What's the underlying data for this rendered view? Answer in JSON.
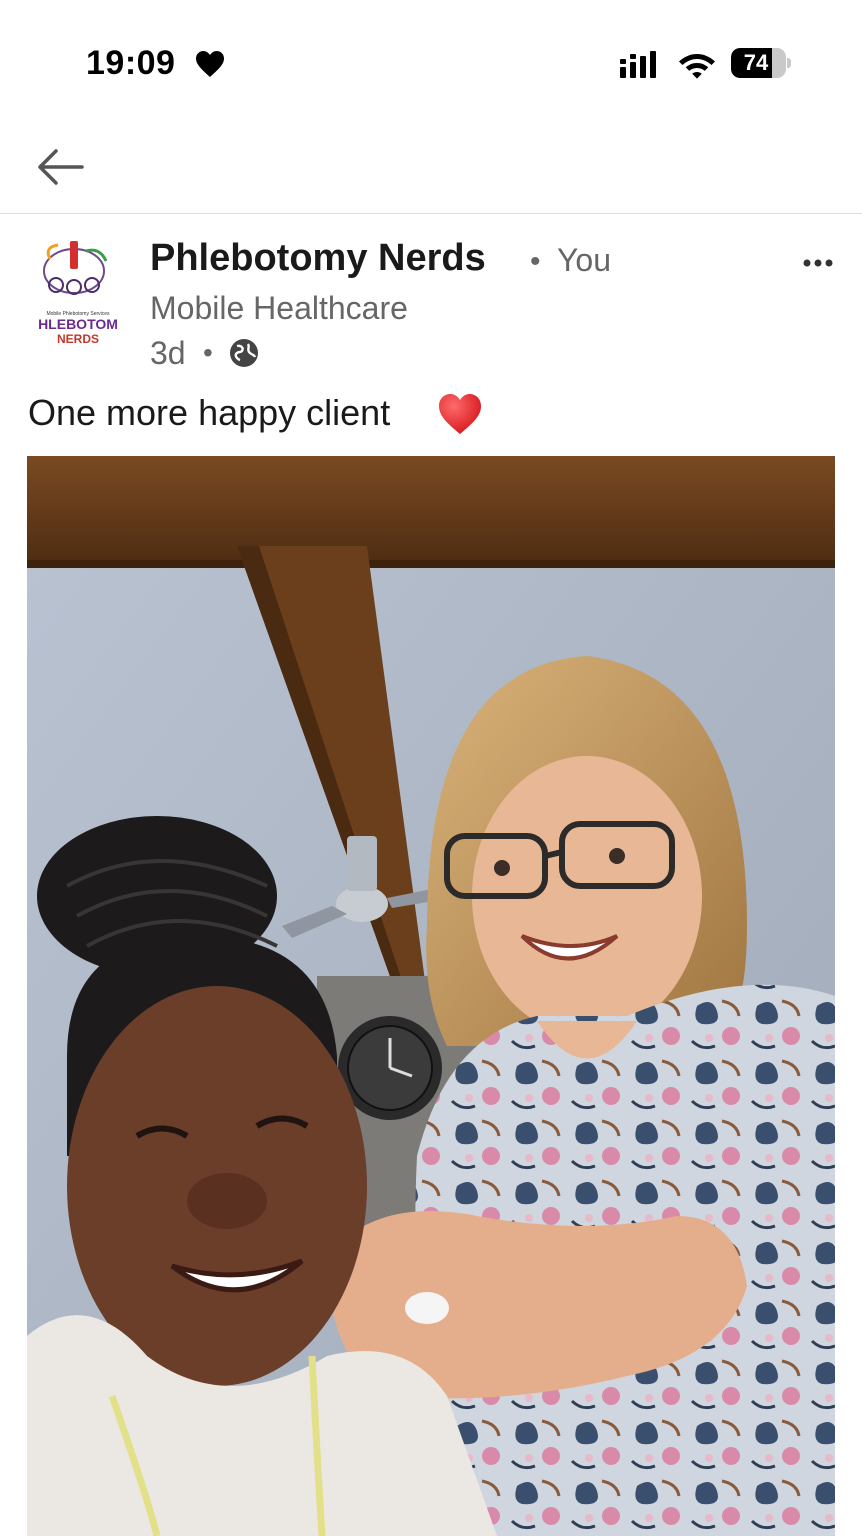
{
  "status_bar": {
    "time": "19:09",
    "battery_level": "74",
    "battery_fraction": 0.74,
    "icons": [
      "heart-icon",
      "signal-icon",
      "wifi-icon",
      "battery-icon"
    ]
  },
  "nav": {
    "back_icon": "arrow-left-icon"
  },
  "post": {
    "author": "Phlebotomy Nerds",
    "separator": "•",
    "relation": "You",
    "tagline": "Mobile Healthcare",
    "age": "3d",
    "visibility_icon": "globe-icon",
    "more_icon": "more-horizontal-icon",
    "text": "One more happy client",
    "text_emoji": "red-heart-emoji",
    "logo_text": "PHLEBOTOMY NERDS"
  },
  "colors": {
    "text_primary": "#1a1a1a",
    "text_secondary": "#666666",
    "divider": "#dedede",
    "heart_red": "#e0262c"
  }
}
